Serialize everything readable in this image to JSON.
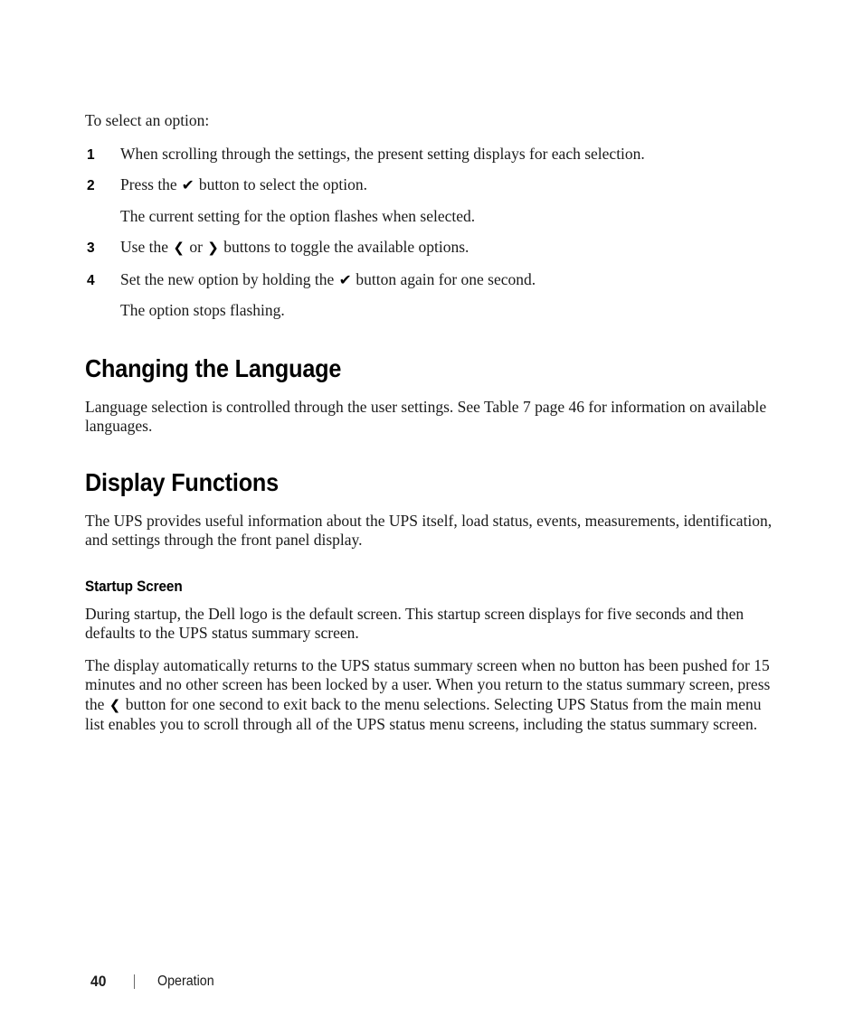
{
  "page": {
    "background_color": "#ffffff",
    "text_color": "#1a1a1a"
  },
  "intro": {
    "lead": "To select an option:"
  },
  "steps": [
    {
      "number": "1",
      "text_before": "When scrolling through the settings, the present setting displays for each selection.",
      "glyph": "",
      "text_after": ""
    },
    {
      "number": "2",
      "text_before": "Press the ",
      "glyph": "✔",
      "glyph_name": "down-arrow-select-button-icon",
      "text_after": " button to select the option.",
      "note": "The current setting for the option flashes when selected."
    },
    {
      "number": "3",
      "text_before": "Use the ",
      "glyph": "❮",
      "glyph_name": "left-chevron-button-icon",
      "text_mid": " or ",
      "glyph2": "❯",
      "glyph2_name": "right-chevron-button-icon",
      "text_after": " buttons to toggle the available options."
    },
    {
      "number": "4",
      "text_before": "Set the new option by holding the ",
      "glyph": "✔",
      "glyph_name": "down-arrow-select-button-icon",
      "text_after": " button again for one second.",
      "note": "The option stops flashing."
    }
  ],
  "sections": [
    {
      "heading": "Changing the Language",
      "paragraphs": [
        "Language selection is controlled through the user settings. See Table 7 page 46 for information on available languages."
      ]
    },
    {
      "heading": "Display Functions",
      "paragraphs": [
        "The UPS provides useful information about the UPS itself, load status, events, measurements, identification, and settings through the front panel display."
      ],
      "subsection": {
        "heading": "Startup Screen",
        "paragraphs": [
          "During startup, the Dell logo is the default screen. This startup screen displays for five seconds and then defaults to the UPS status summary screen."
        ],
        "long_paragraph": {
          "part1": "The display automatically returns to the UPS status summary screen when no button has been pushed for 15 minutes and no other screen has been locked by a user. When you return to the status summary screen, press the ",
          "glyph": "❮",
          "glyph_name": "left-chevron-button-icon",
          "part2": " button for one second to exit back to the menu selections. Selecting UPS Status from the main menu list enables you to scroll through all of the UPS status menu screens, including the status summary screen."
        }
      }
    }
  ],
  "footer": {
    "page_number": "40",
    "separator": "|",
    "section_name": "Operation"
  }
}
